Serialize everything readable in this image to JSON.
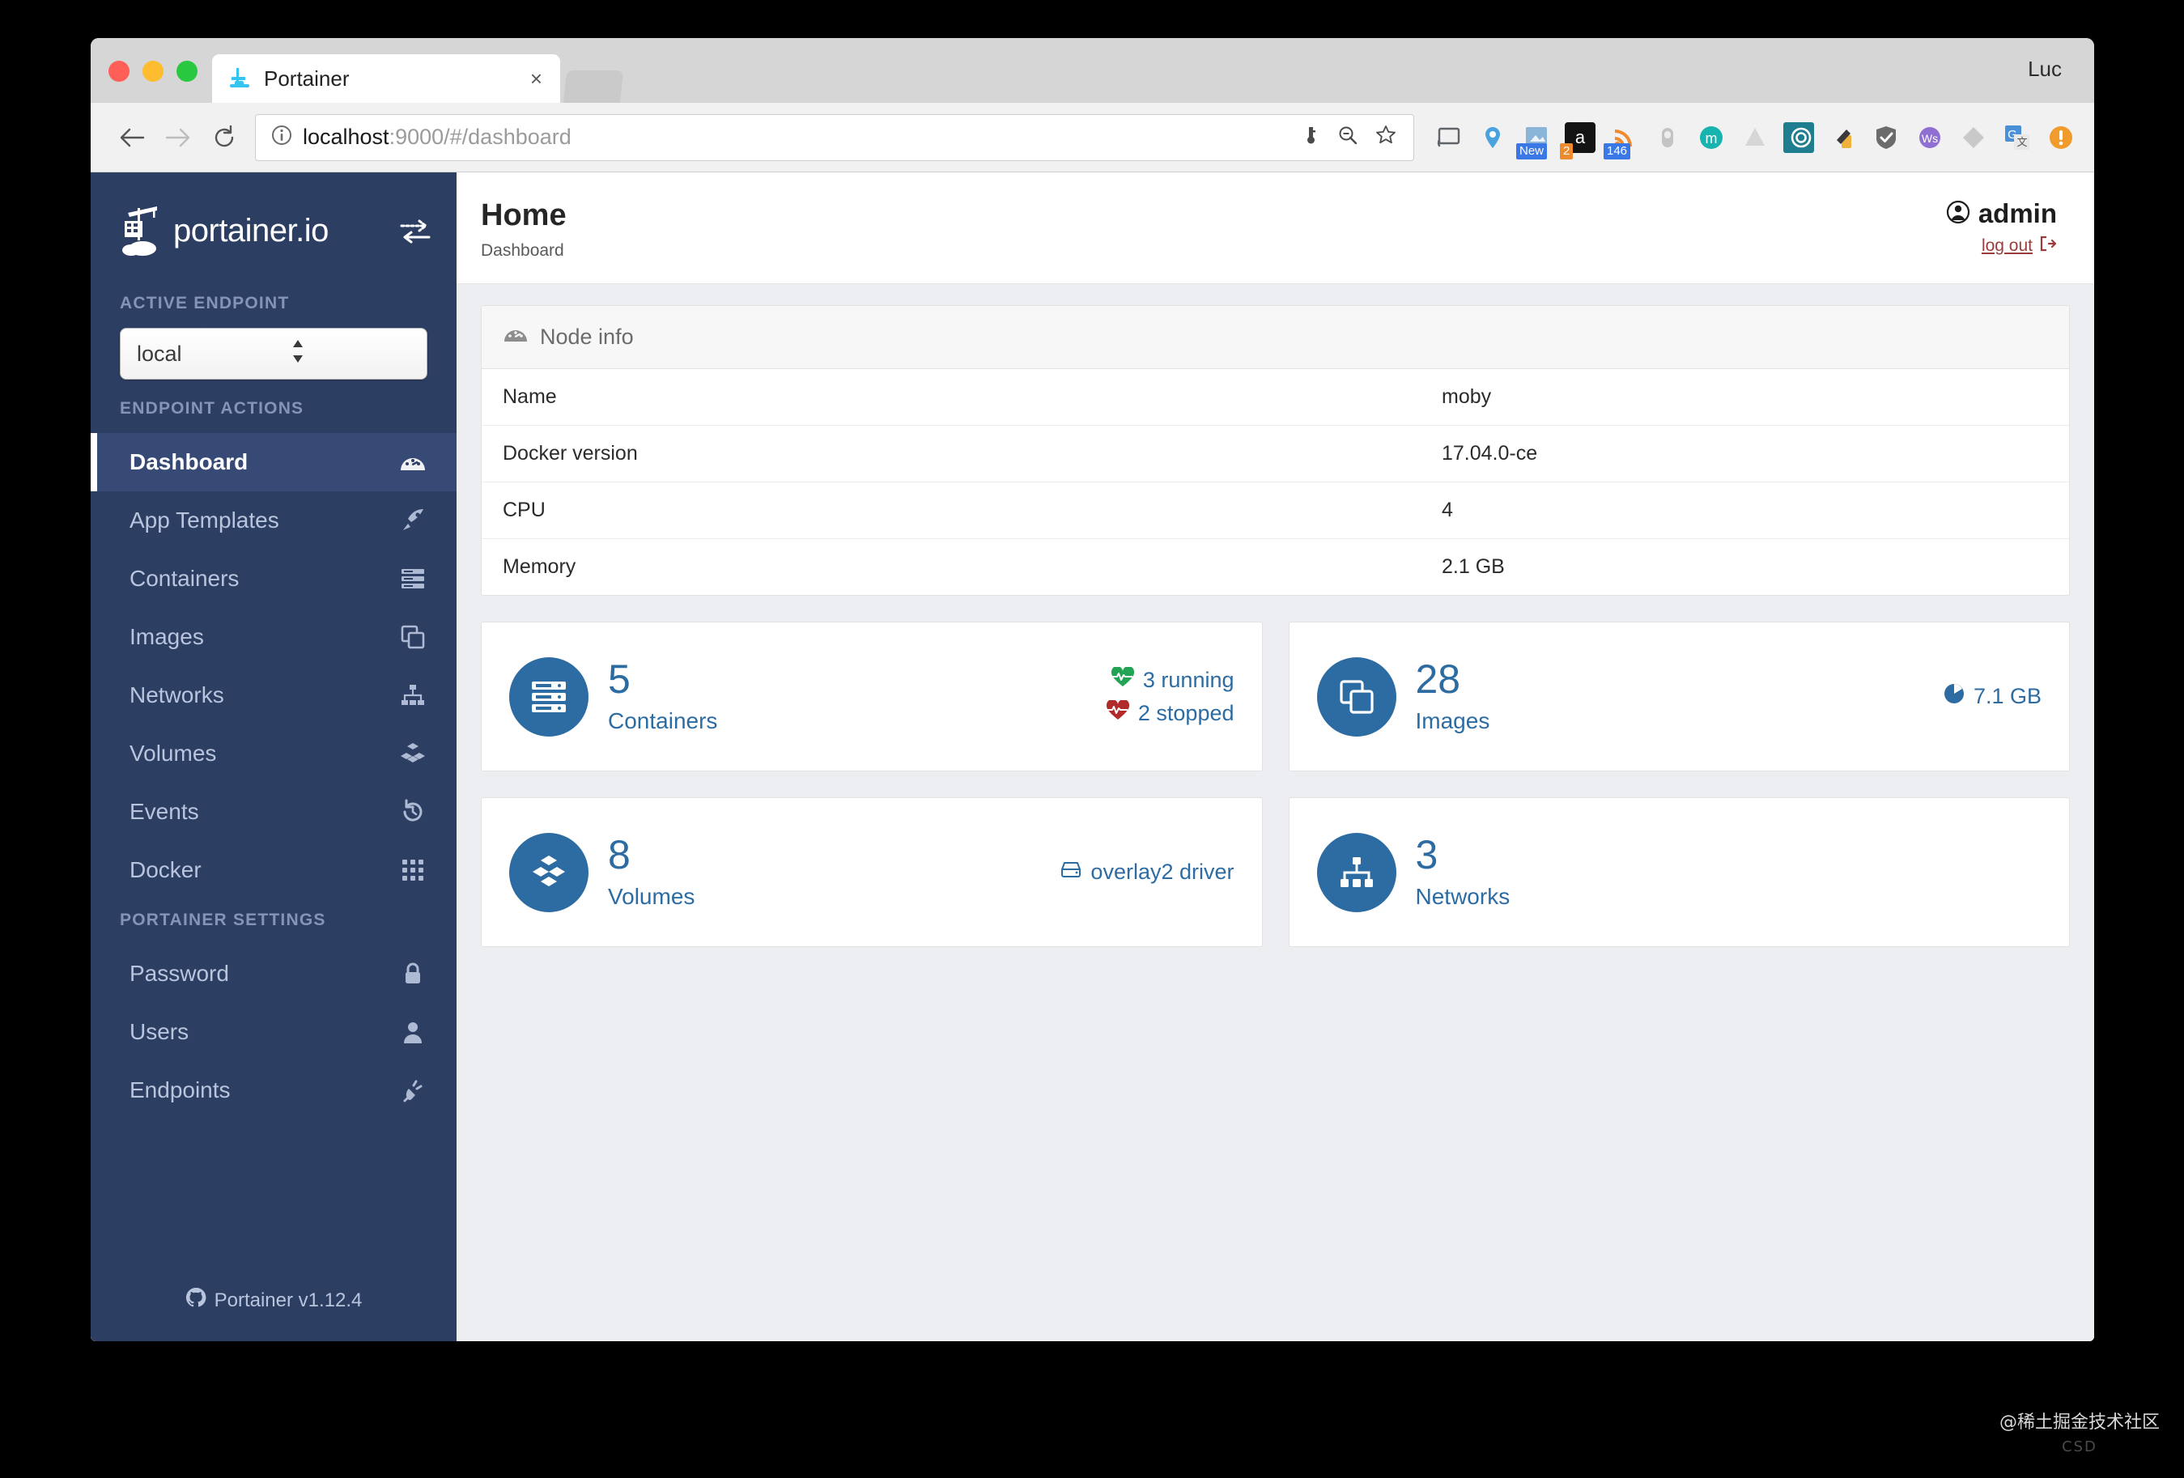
{
  "browser": {
    "tab": {
      "title": "Portainer",
      "favicon": "docker-whale-icon",
      "close": "×"
    },
    "profile_name": "Luc",
    "address": {
      "host": "localhost",
      "path": ":9000/#/dashboard"
    },
    "omni_icons": [
      "key-icon",
      "zoom-out-icon",
      "bookmark-star-icon"
    ],
    "extensions": [
      {
        "name": "cast-icon",
        "color": "#5f6368",
        "badge": ""
      },
      {
        "name": "location-pin-icon",
        "color": "#4aa3df",
        "badge": ""
      },
      {
        "name": "screenshot-icon",
        "color": "#8ab4d8",
        "badge": "New"
      },
      {
        "name": "amazon-icon",
        "color": "#141414",
        "badge": "2"
      },
      {
        "name": "rss-feed-icon",
        "color": "#ef8b2c",
        "badge": "146"
      },
      {
        "name": "pill-icon",
        "color": "#c4c4c4",
        "badge": ""
      },
      {
        "name": "mega-icon",
        "color": "#17b3ae",
        "badge": ""
      },
      {
        "name": "drive-icon",
        "color": "#d6d6d6",
        "badge": ""
      },
      {
        "name": "bittorrent-icon",
        "color": "#1e7d8f",
        "badge": ""
      },
      {
        "name": "eyedropper-icon",
        "color": "#efb13c",
        "badge": ""
      },
      {
        "name": "shield-check-icon",
        "color": "#6b6b6b",
        "badge": ""
      },
      {
        "name": "ws-badge-icon",
        "color": "#8f6fd1",
        "badge": ""
      },
      {
        "name": "diamond-icon",
        "color": "#c9c9c9",
        "badge": ""
      },
      {
        "name": "google-translate-icon",
        "color": "#4a90d9",
        "badge": ""
      },
      {
        "name": "alert-icon",
        "color": "#ef9c2c",
        "badge": ""
      }
    ]
  },
  "sidebar": {
    "brand": "portainer.io",
    "switch_icon": "endpoint-switch-icon",
    "active_endpoint_label": "ACTIVE ENDPOINT",
    "endpoint_value": "local",
    "endpoint_actions_label": "ENDPOINT ACTIONS",
    "settings_label": "PORTAINER SETTINGS",
    "actions": [
      {
        "label": "Dashboard",
        "icon": "gauge-icon",
        "active": true
      },
      {
        "label": "App Templates",
        "icon": "rocket-icon",
        "active": false
      },
      {
        "label": "Containers",
        "icon": "server-rack-icon",
        "active": false
      },
      {
        "label": "Images",
        "icon": "copy-icon",
        "active": false
      },
      {
        "label": "Networks",
        "icon": "sitemap-icon",
        "active": false
      },
      {
        "label": "Volumes",
        "icon": "cubes-icon",
        "active": false
      },
      {
        "label": "Events",
        "icon": "history-icon",
        "active": false
      },
      {
        "label": "Docker",
        "icon": "grid-icon",
        "active": false
      }
    ],
    "settings": [
      {
        "label": "Password",
        "icon": "lock-icon"
      },
      {
        "label": "Users",
        "icon": "user-icon"
      },
      {
        "label": "Endpoints",
        "icon": "plug-icon"
      }
    ],
    "footer": {
      "text": "Portainer v1.12.4",
      "icon": "github-icon"
    }
  },
  "header": {
    "title": "Home",
    "subtitle": "Dashboard",
    "user": "admin",
    "user_icon": "user-circle-icon",
    "logout": "log out",
    "logout_icon": "sign-out-icon"
  },
  "node_info": {
    "panel_title": "Node info",
    "panel_icon": "gauge-icon",
    "rows": [
      {
        "key": "Name",
        "value": "moby"
      },
      {
        "key": "Docker version",
        "value": "17.04.0-ce"
      },
      {
        "key": "CPU",
        "value": "4"
      },
      {
        "key": "Memory",
        "value": "2.1 GB"
      }
    ]
  },
  "cards": [
    {
      "value": "5",
      "label": "Containers",
      "icon": "server-rack-icon",
      "stats": [
        {
          "text": "3 running",
          "icon": "heartbeat-icon",
          "color": "#23a455"
        },
        {
          "text": "2 stopped",
          "icon": "heartbeat-icon",
          "color": "#b12b2b"
        }
      ]
    },
    {
      "value": "28",
      "label": "Images",
      "icon": "copy-icon",
      "stats": [
        {
          "text": "7.1 GB",
          "icon": "pie-chart-icon",
          "color": "#2d6ca2"
        }
      ]
    },
    {
      "value": "8",
      "label": "Volumes",
      "icon": "cubes-icon",
      "stats": [
        {
          "text": "overlay2 driver",
          "icon": "hdd-icon",
          "color": "#2d6ca2"
        }
      ]
    },
    {
      "value": "3",
      "label": "Networks",
      "icon": "sitemap-icon",
      "stats": []
    }
  ],
  "watermark": {
    "text": "@稀土掘金技术社区",
    "sub": "CSD"
  },
  "colors": {
    "sidebar": "#2d3e63",
    "sidebar_active": "#374a75",
    "accent_blue": "#2d6ca2",
    "running_green": "#23a455",
    "stopped_red": "#b12b2b",
    "logout_red": "#9b3b3b"
  }
}
